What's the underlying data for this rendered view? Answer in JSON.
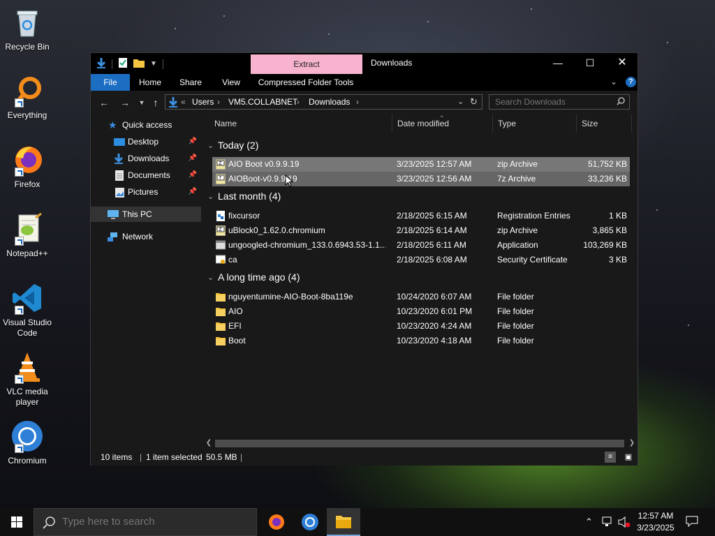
{
  "desktop": {
    "icons": [
      {
        "label": "Recycle Bin",
        "icon": "recycle-bin-icon"
      },
      {
        "label": "Everything",
        "icon": "everything-search-icon"
      },
      {
        "label": "Firefox",
        "icon": "firefox-icon"
      },
      {
        "label": "Notepad++",
        "icon": "notepad-plus-plus-icon"
      },
      {
        "label": "Visual Studio Code",
        "icon": "vscode-icon"
      },
      {
        "label": "VLC media player",
        "icon": "vlc-icon"
      },
      {
        "label": "Chromium",
        "icon": "chromium-icon"
      }
    ]
  },
  "window": {
    "title": "Downloads",
    "context_tab": "Extract",
    "ribbon_tabs": [
      "File",
      "Home",
      "Share",
      "View",
      "Compressed Folder Tools"
    ],
    "address": {
      "overflow": "«",
      "crumbs": [
        "Users",
        "VM5.COLLABNET",
        "Downloads"
      ]
    },
    "search_placeholder": "Search Downloads",
    "nav": {
      "quick_access": "Quick access",
      "pinned": [
        "Desktop",
        "Downloads",
        "Documents",
        "Pictures"
      ],
      "this_pc": "This PC",
      "network": "Network"
    },
    "columns": [
      "Name",
      "Date modified",
      "Type",
      "Size"
    ],
    "groups": [
      {
        "label": "Today (2)",
        "files": [
          {
            "name": "AIO Boot v0.9.9.19",
            "date": "3/23/2025 12:57 AM",
            "type": "zip Archive",
            "size": "51,752 KB",
            "icon": "zip-archive-icon",
            "selected": true
          },
          {
            "name": "AIOBoot-v0.9.9.19",
            "date": "3/23/2025 12:56 AM",
            "type": "7z Archive",
            "size": "33,236 KB",
            "icon": "7z-archive-icon",
            "hovered": true
          }
        ]
      },
      {
        "label": "Last month (4)",
        "files": [
          {
            "name": "fixcursor",
            "date": "2/18/2025 6:15 AM",
            "type": "Registration Entries",
            "size": "1 KB",
            "icon": "registry-file-icon"
          },
          {
            "name": "uBlock0_1.62.0.chromium",
            "date": "2/18/2025 6:14 AM",
            "type": "zip Archive",
            "size": "3,865 KB",
            "icon": "zip-archive-icon"
          },
          {
            "name": "ungoogled-chromium_133.0.6943.53-1.1...",
            "date": "2/18/2025 6:11 AM",
            "type": "Application",
            "size": "103,269 KB",
            "icon": "application-icon"
          },
          {
            "name": "ca",
            "date": "2/18/2025 6:08 AM",
            "type": "Security Certificate",
            "size": "3 KB",
            "icon": "certificate-icon"
          }
        ]
      },
      {
        "label": "A long time ago (4)",
        "files": [
          {
            "name": "nguyentumine-AIO-Boot-8ba119e",
            "date": "10/24/2020 6:07 AM",
            "type": "File folder",
            "size": "",
            "icon": "folder-icon"
          },
          {
            "name": "AIO",
            "date": "10/23/2020 6:01 PM",
            "type": "File folder",
            "size": "",
            "icon": "folder-icon"
          },
          {
            "name": "EFI",
            "date": "10/23/2020 4:24 AM",
            "type": "File folder",
            "size": "",
            "icon": "folder-icon"
          },
          {
            "name": "Boot",
            "date": "10/23/2020 4:18 AM",
            "type": "File folder",
            "size": "",
            "icon": "folder-icon"
          }
        ]
      }
    ],
    "status": {
      "items": "10 items",
      "selected": "1 item selected",
      "size": "50.5 MB"
    }
  },
  "taskbar": {
    "search_placeholder": "Type here to search",
    "time": "12:57 AM",
    "date": "3/23/2025"
  },
  "colors": {
    "file_tab": "#1b6ec2",
    "context_tab": "#f8b4cf",
    "selection": "#777777"
  }
}
